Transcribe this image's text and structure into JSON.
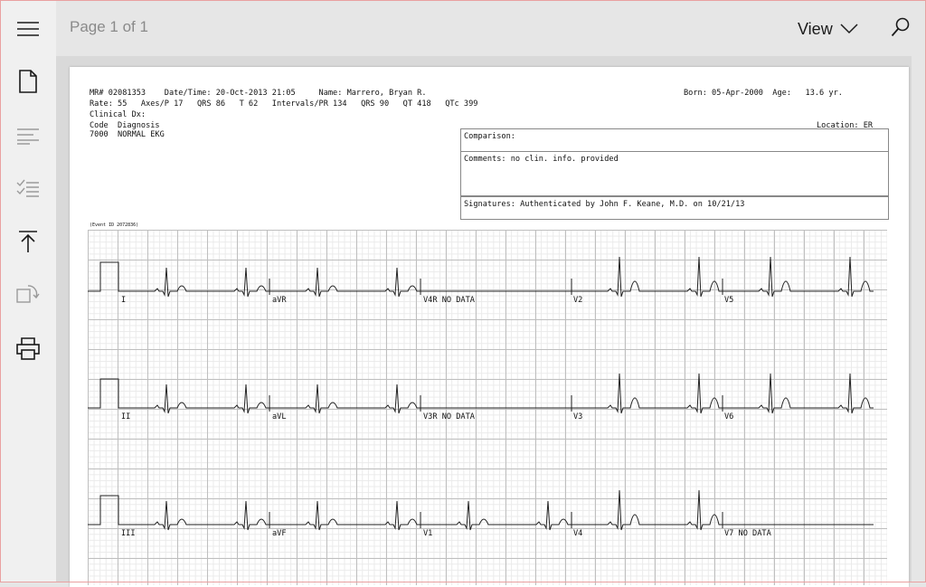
{
  "toolbar": {
    "page_label": "Page 1 of 1",
    "view_label": "View"
  },
  "rail_icons": [
    "menu-icon",
    "document-icon",
    "text-icon",
    "checklist-icon",
    "jump-top-icon",
    "rotate-icon",
    "print-icon"
  ],
  "report": {
    "line1": "MR# 02081353    Date/Time: 20-Oct-2013 21:05     Name: Marrero, Bryan R.",
    "born": "Born: 05-Apr-2000  Age:   13.6 yr.",
    "line2": "Rate: 55   Axes/P 17   QRS 86   T 62   Intervals/PR 134   QRS 90   QT 418   QTc 399",
    "line3": "Clinical Dx:",
    "code_header": "Code  Diagnosis",
    "code_row": "7000  NORMAL EKG",
    "location": "Location: ER",
    "comparison": "Comparison:",
    "comments": "Comments: no clin. info. provided",
    "signatures": "Signatures: Authenticated by John F. Keane, M.D. on 10/21/13",
    "event_id": "(Event ID 2072836)"
  },
  "leads": {
    "row1": [
      "I",
      "aVR",
      "V4R NO DATA",
      "V2",
      "V5"
    ],
    "row2": [
      "II",
      "aVL",
      "V3R NO DATA",
      "V3",
      "V6"
    ],
    "row3": [
      "III",
      "aVF",
      "V1",
      "V4",
      "V7 NO DATA"
    ]
  }
}
